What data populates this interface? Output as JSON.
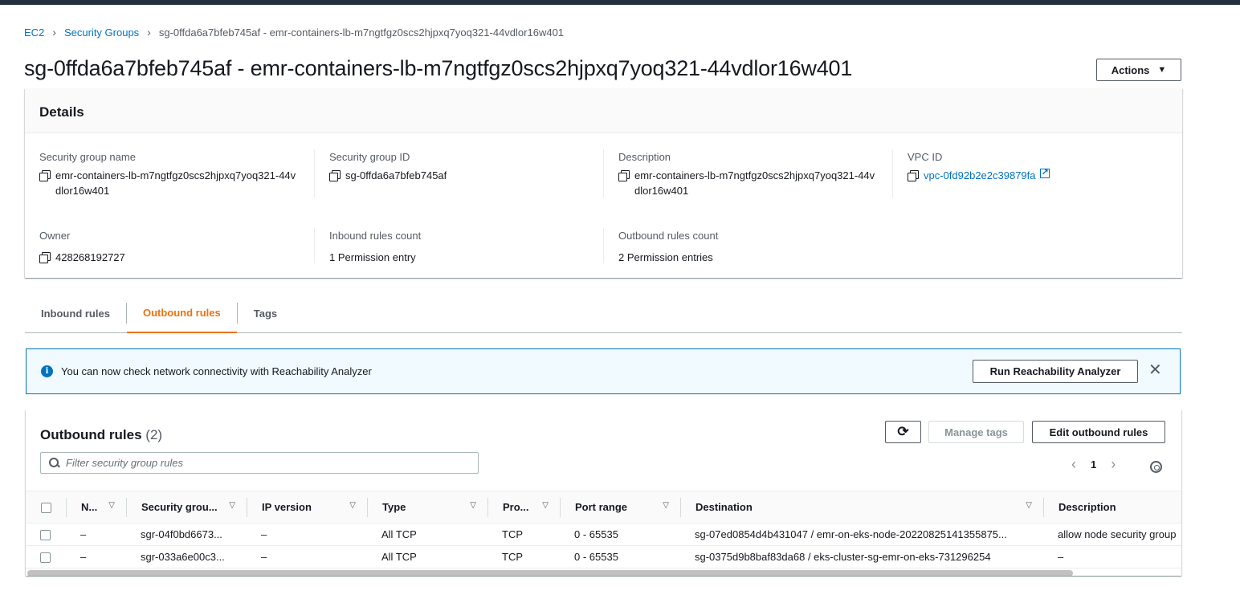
{
  "breadcrumb": {
    "ec2": "EC2",
    "security_groups": "Security Groups",
    "current": "sg-0ffda6a7bfeb745af - emr-containers-lb-m7ngtfgz0scs2hjpxq7yoq321-44vdlor16w401"
  },
  "page_title": "sg-0ffda6a7bfeb745af - emr-containers-lb-m7ngtfgz0scs2hjpxq7yoq321-44vdlor16w401",
  "actions_label": "Actions",
  "details": {
    "header": "Details",
    "sg_name_label": "Security group name",
    "sg_name_value": "emr-containers-lb-m7ngtfgz0scs2hjpxq7yoq321-44vdlor16w401",
    "sg_id_label": "Security group ID",
    "sg_id_value": "sg-0ffda6a7bfeb745af",
    "description_label": "Description",
    "description_value": "emr-containers-lb-m7ngtfgz0scs2hjpxq7yoq321-44vdlor16w401",
    "vpc_label": "VPC ID",
    "vpc_value": "vpc-0fd92b2e2c39879fa",
    "owner_label": "Owner",
    "owner_value": "428268192727",
    "inbound_count_label": "Inbound rules count",
    "inbound_count_value": "1 Permission entry",
    "outbound_count_label": "Outbound rules count",
    "outbound_count_value": "2 Permission entries"
  },
  "tabs": [
    "Inbound rules",
    "Outbound rules",
    "Tags"
  ],
  "active_tab": "Outbound rules",
  "alert": {
    "text": "You can now check network connectivity with Reachability Analyzer",
    "button": "Run Reachability Analyzer"
  },
  "rules": {
    "title": "Outbound rules",
    "count": "(2)",
    "manage_tags": "Manage tags",
    "edit_button": "Edit outbound rules",
    "filter_placeholder": "Filter security group rules",
    "page": "1",
    "columns": [
      "N...",
      "Security grou...",
      "IP version",
      "Type",
      "Pro...",
      "Port range",
      "Destination",
      "Description"
    ],
    "rows": [
      [
        "–",
        "sgr-04f0bd6673...",
        "–",
        "All TCP",
        "TCP",
        "0 - 65535",
        "sg-07ed0854d4b431047 / emr-on-eks-node-20220825141355875...",
        "allow node security group"
      ],
      [
        "–",
        "sgr-033a6e00c3...",
        "–",
        "All TCP",
        "TCP",
        "0 - 65535",
        "sg-0375d9b8baf83da68 / eks-cluster-sg-emr-on-eks-731296254",
        "–"
      ]
    ]
  },
  "colors": {
    "accent_orange": "#ec7211",
    "link_blue": "#0073bb",
    "info_bg": "#f1faff"
  }
}
